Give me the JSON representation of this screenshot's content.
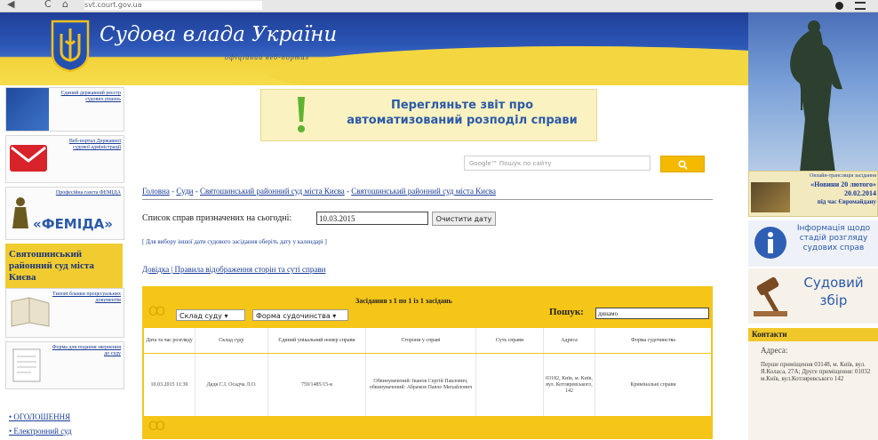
{
  "browser": {
    "nav_back": "◀",
    "nav_reload": "C",
    "nav_home": "⌂",
    "url": "svt.court.gov.ua",
    "menu_icon": "menu-icon"
  },
  "header": {
    "title": "Судова влада України",
    "subtitle": "офіційний веб-портал"
  },
  "left_sidebar": {
    "boxes": [
      {
        "label": "Єдиний державний реєстр судових рішень"
      },
      {
        "label": "Веб-портал Державної судової адміністрації"
      },
      {
        "label": "Професійна газета ФЕМІДА"
      },
      {
        "label": "Типові бланки процесуальних документів"
      },
      {
        "label": "Форма для подання звернення до суду"
      }
    ],
    "femida_logo_text": "«ФЕМІДА»",
    "court_name": "Святошинський районний суд міста Києва",
    "links": [
      "• ОГОЛОШЕННЯ",
      "• Електронний суд"
    ]
  },
  "banner": {
    "line1": "Перегляньте звіт про",
    "line2": "автоматизований розподіл справи"
  },
  "search": {
    "placeholder": "Google™ Пошук по сайту",
    "button": "🔍"
  },
  "breadcrumb": {
    "items": [
      "Головна",
      "Суди",
      "Святошинський районний суд міста Києва",
      "Святошинський районний суд міста Києва"
    ],
    "separator": " - "
  },
  "schedule": {
    "label": "Список справ призначених на сьогодні:",
    "date_value": "10.03.2015",
    "clear_button": "Очистити дату"
  },
  "hint": "[ Для вибору іншої дати судового засідання оберіть дату у календарі ]",
  "help_links": {
    "first": "Довідка",
    "separator": " | ",
    "second": "Правила відображення сторін та суті справи"
  },
  "table": {
    "info": "Засідання з 1 по 1 із 1 засідань",
    "court_select": "Склад суду",
    "form_select": "Форма судочинства",
    "filter_label": "Пошук:",
    "filter_value": "динамо",
    "columns": [
      "Дата та час розгляду",
      "Склад суду",
      "Єдиний унікальний номер справи",
      "Сторони у справі",
      "Суть справи",
      "Адреса",
      "Форма судочинства"
    ],
    "rows": [
      [
        "10.03.2015 11:30",
        "Дядя С.І. Осадча Л.О.",
        "759/1485/15-к",
        "Обвинувачений: Іванов Сергій Павлович, обвинувачений: Абрамов Павло Михайлович",
        "",
        "03182, Київ, м. Київ, вул. Котляревського, 142",
        "Кримінальні справи"
      ]
    ],
    "circles": "OO"
  },
  "right_sidebar": {
    "news_title": "Онлайн-трансляція засідання",
    "news_date": "«Новини 20 лютого»",
    "news_date2": "20.02.2014",
    "news_time": "під час Євромайдану",
    "info_title": "Інформація щодо стадій розгляду судових справ",
    "fee_title": "Судовий збір",
    "contacts_title": "Контакти",
    "address_label": "Адреса:",
    "address_text": "Перше приміщення 03148, м. Київ, вул. Я.Коласа, 27А; Друге приміщення: 01032 м.Київ, вул.Котляревського 142"
  },
  "colors": {
    "header_blue": "#1f3f98",
    "accent_yellow": "#f5c518",
    "link_blue": "#1a3c96"
  }
}
